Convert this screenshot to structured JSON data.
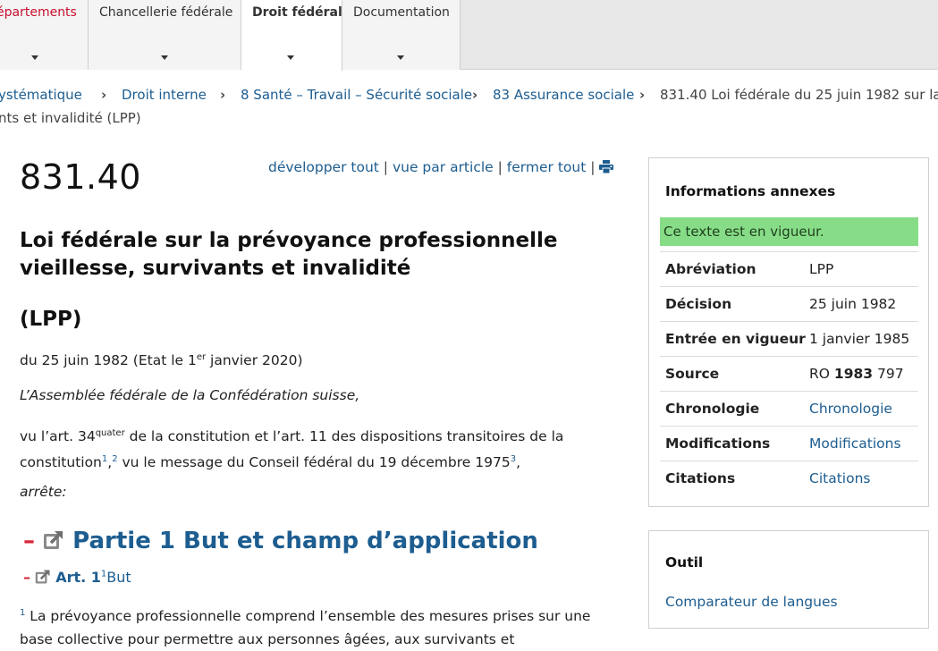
{
  "nav": {
    "tabs": [
      {
        "label": "épartements"
      },
      {
        "label": "Chancellerie fédérale"
      },
      {
        "label": "Droit fédéral"
      },
      {
        "label": "Documentation"
      }
    ]
  },
  "breadcrumb": {
    "items": [
      "ystématique",
      "Droit interne",
      "8 Santé – Travail – Sécurité sociale",
      "83 Assurance sociale",
      "831.40 Loi fédérale du 25 juin 1982 sur la"
    ],
    "separator": "›",
    "continuation": "nts et invalidité (LPP)"
  },
  "document": {
    "rs_number": "831.40",
    "tools": {
      "expand_all": "développer tout",
      "by_article": "vue par article",
      "close_all": "fermer tout",
      "separator": "|"
    },
    "title_line1": "Loi fédérale sur la prévoyance professionnelle",
    "title_line2": "vieillesse, survivants et invalidité",
    "abbreviation": "(LPP)",
    "date_prefix": "du 25 juin 1982 (Etat le 1",
    "date_sup": "er",
    "date_suffix": " janvier 2020)",
    "preamble_intro": "L’Assemblée fédérale de la Confédération suisse,",
    "preamble_1": "vu l’art. 34",
    "preamble_sup": "quater",
    "preamble_2": " de la constitution et l’art. 11 des dispositions transitoires de la constitution",
    "fn1": "1",
    "fn_comma": ",",
    "fn2": "2",
    "preamble_3": " vu le message du Conseil fédéral du 19 décembre 1975",
    "fn3": "3",
    "preamble_end": ",",
    "arrete": "arrête:",
    "part_minus": "–",
    "part_title": "Partie 1 But et champ d’application",
    "article_minus": "–",
    "article_number": "Art. 1",
    "article_sup": "1",
    "article_title": "But",
    "article_para_num": "1",
    "article_text": " La prévoyance professionnelle comprend l’ensemble des mesures prises sur une base collective pour permettre aux personnes âgées, aux survivants et"
  },
  "sidebar": {
    "info_title": "Informations annexes",
    "status": "Ce texte est en vigueur.",
    "rows": [
      {
        "key": "Abréviation",
        "value": "LPP"
      },
      {
        "key": "Décision",
        "value": "25 juin 1982"
      },
      {
        "key": "Entrée en vigueur",
        "value": "1 janvier 1985"
      },
      {
        "key": "Source",
        "value_prefix": "RO ",
        "value_bold": "1983",
        "value_suffix": " 797"
      },
      {
        "key": "Chronologie",
        "value": "Chronologie"
      },
      {
        "key": "Modifications",
        "value": "Modifications"
      },
      {
        "key": "Citations",
        "value": "Citations"
      }
    ],
    "tool_title": "Outil",
    "tool_link": "Comparateur de langues"
  },
  "colors": {
    "link": "#1d5d90",
    "in_force_bg": "#87dd87",
    "collapse_red": "#d6263a",
    "active_tab_red": "#c8102e"
  },
  "icons": [
    "chevron-down-icon",
    "print-icon",
    "external-link-icon",
    "collapse-icon"
  ]
}
